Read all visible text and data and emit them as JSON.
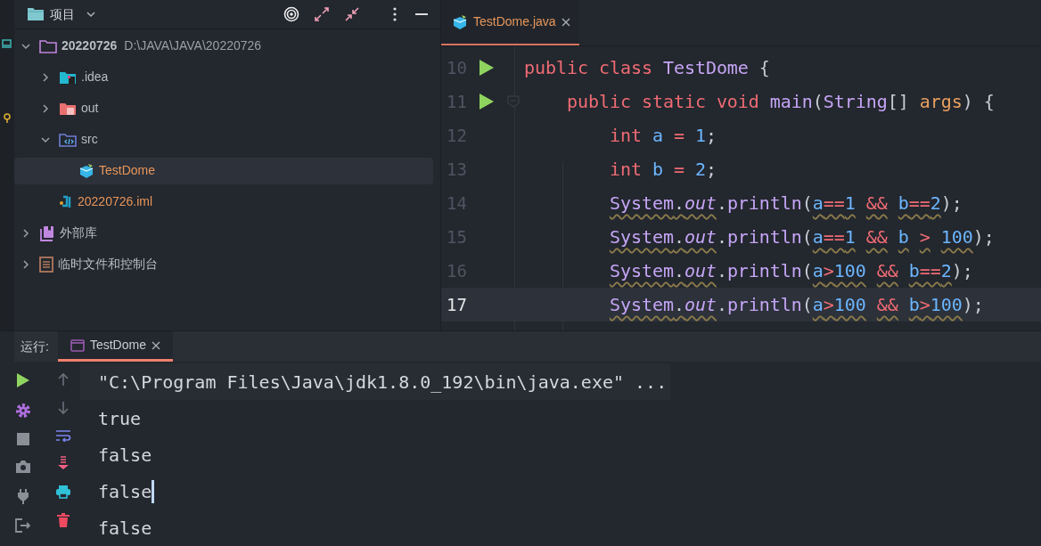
{
  "project_panel": {
    "title": "项目",
    "tree": [
      {
        "label": "20220726",
        "path": "D:\\JAVA\\JAVA\\20220726",
        "kind": "module",
        "expanded": true,
        "selected": false,
        "color": "#b8bcc4",
        "children": [
          {
            "label": ".idea",
            "kind": "idea-folder",
            "expanded": false,
            "selected": false,
            "color": "#b8bcc4"
          },
          {
            "label": "out",
            "kind": "out-folder",
            "expanded": false,
            "selected": false,
            "color": "#b8bcc4"
          },
          {
            "label": "src",
            "kind": "source-folder",
            "expanded": true,
            "selected": false,
            "color": "#b8bcc4",
            "children": [
              {
                "label": "TestDome",
                "kind": "java-class",
                "selected": true,
                "color": "#e8965a"
              }
            ]
          },
          {
            "label": "20220726.iml",
            "kind": "iml-file",
            "selected": false,
            "color": "#e8965a"
          }
        ]
      },
      {
        "label": "外部库",
        "kind": "library",
        "expanded": false,
        "selected": false,
        "color": "#b8bcc4"
      },
      {
        "label": "临时文件和控制台",
        "kind": "scratch",
        "expanded": false,
        "selected": false,
        "color": "#b8bcc4"
      }
    ]
  },
  "editor": {
    "tabs": [
      {
        "label": "TestDome.java",
        "selected": true
      }
    ],
    "lines": [
      {
        "number": "10",
        "runnable": true,
        "foldable": false,
        "current": false,
        "tokens": [
          {
            "text": "public",
            "kind": "keyword",
            "squiggle": false
          },
          {
            "text": " class",
            "kind": "keyword",
            "squiggle": false
          },
          {
            "text": " TestDome",
            "kind": "type",
            "squiggle": false
          },
          {
            "text": " {",
            "kind": "punct",
            "squiggle": false
          }
        ]
      },
      {
        "number": "11",
        "runnable": true,
        "foldable": true,
        "current": false,
        "tokens": [
          {
            "text": "    public",
            "kind": "keyword",
            "squiggle": false
          },
          {
            "text": " static",
            "kind": "keyword",
            "squiggle": false
          },
          {
            "text": " void",
            "kind": "keyword",
            "squiggle": false
          },
          {
            "text": " main",
            "kind": "method",
            "squiggle": false
          },
          {
            "text": "(",
            "kind": "punct",
            "squiggle": false
          },
          {
            "text": "String",
            "kind": "type",
            "squiggle": false
          },
          {
            "text": "[]",
            "kind": "punct",
            "squiggle": false
          },
          {
            "text": " args",
            "kind": "param",
            "squiggle": false
          },
          {
            "text": ")",
            "kind": "punct",
            "squiggle": false
          },
          {
            "text": " {",
            "kind": "punct",
            "squiggle": false
          }
        ]
      },
      {
        "number": "12",
        "runnable": false,
        "foldable": false,
        "current": false,
        "tokens": [
          {
            "text": "        int",
            "kind": "keyword",
            "squiggle": false
          },
          {
            "text": " a",
            "kind": "variable",
            "squiggle": false
          },
          {
            "text": " =",
            "kind": "operator",
            "squiggle": false
          },
          {
            "text": " 1",
            "kind": "number",
            "squiggle": false
          },
          {
            "text": ";",
            "kind": "punct",
            "squiggle": false
          }
        ]
      },
      {
        "number": "13",
        "runnable": false,
        "foldable": false,
        "current": false,
        "tokens": [
          {
            "text": "        int",
            "kind": "keyword",
            "squiggle": false
          },
          {
            "text": " b",
            "kind": "variable",
            "squiggle": false
          },
          {
            "text": " =",
            "kind": "operator",
            "squiggle": false
          },
          {
            "text": " 2",
            "kind": "number",
            "squiggle": false
          },
          {
            "text": ";",
            "kind": "punct",
            "squiggle": false
          }
        ]
      },
      {
        "number": "14",
        "runnable": false,
        "foldable": false,
        "current": false,
        "tokens": [
          {
            "text": "        System",
            "kind": "type",
            "squiggle": true
          },
          {
            "text": ".",
            "kind": "punct",
            "squiggle": true
          },
          {
            "text": "out",
            "kind": "field",
            "squiggle": true
          },
          {
            "text": ".",
            "kind": "punct",
            "squiggle": false
          },
          {
            "text": "println",
            "kind": "method",
            "squiggle": false
          },
          {
            "text": "(",
            "kind": "punct",
            "squiggle": false
          },
          {
            "text": "a",
            "kind": "variable",
            "squiggle": true
          },
          {
            "text": "==",
            "kind": "operator",
            "squiggle": true
          },
          {
            "text": "1",
            "kind": "number",
            "squiggle": true
          },
          {
            "text": " &&",
            "kind": "operator",
            "squiggle": true
          },
          {
            "text": " b",
            "kind": "variable",
            "squiggle": true
          },
          {
            "text": "==",
            "kind": "operator",
            "squiggle": true
          },
          {
            "text": "2",
            "kind": "number",
            "squiggle": true
          },
          {
            "text": ")",
            "kind": "punct",
            "squiggle": false
          },
          {
            "text": ";",
            "kind": "punct",
            "squiggle": false
          }
        ]
      },
      {
        "number": "15",
        "runnable": false,
        "foldable": false,
        "current": false,
        "tokens": [
          {
            "text": "        System",
            "kind": "type",
            "squiggle": true
          },
          {
            "text": ".",
            "kind": "punct",
            "squiggle": true
          },
          {
            "text": "out",
            "kind": "field",
            "squiggle": true
          },
          {
            "text": ".",
            "kind": "punct",
            "squiggle": false
          },
          {
            "text": "println",
            "kind": "method",
            "squiggle": false
          },
          {
            "text": "(",
            "kind": "punct",
            "squiggle": false
          },
          {
            "text": "a",
            "kind": "variable",
            "squiggle": true
          },
          {
            "text": "==",
            "kind": "operator",
            "squiggle": true
          },
          {
            "text": "1",
            "kind": "number",
            "squiggle": true
          },
          {
            "text": " &&",
            "kind": "operator",
            "squiggle": true
          },
          {
            "text": " b",
            "kind": "variable",
            "squiggle": true
          },
          {
            "text": " >",
            "kind": "operator",
            "squiggle": true
          },
          {
            "text": " 100",
            "kind": "number",
            "squiggle": true
          },
          {
            "text": ")",
            "kind": "punct",
            "squiggle": false
          },
          {
            "text": ";",
            "kind": "punct",
            "squiggle": false
          }
        ]
      },
      {
        "number": "16",
        "runnable": false,
        "foldable": false,
        "current": false,
        "tokens": [
          {
            "text": "        System",
            "kind": "type",
            "squiggle": true
          },
          {
            "text": ".",
            "kind": "punct",
            "squiggle": true
          },
          {
            "text": "out",
            "kind": "field",
            "squiggle": true
          },
          {
            "text": ".",
            "kind": "punct",
            "squiggle": false
          },
          {
            "text": "println",
            "kind": "method",
            "squiggle": false
          },
          {
            "text": "(",
            "kind": "punct",
            "squiggle": false
          },
          {
            "text": "a",
            "kind": "variable",
            "squiggle": true
          },
          {
            "text": ">",
            "kind": "operator",
            "squiggle": true
          },
          {
            "text": "100",
            "kind": "number",
            "squiggle": true
          },
          {
            "text": " &&",
            "kind": "operator",
            "squiggle": true
          },
          {
            "text": " b",
            "kind": "variable",
            "squiggle": true
          },
          {
            "text": "==",
            "kind": "operator",
            "squiggle": true
          },
          {
            "text": "2",
            "kind": "number",
            "squiggle": true
          },
          {
            "text": ")",
            "kind": "punct",
            "squiggle": false
          },
          {
            "text": ";",
            "kind": "punct",
            "squiggle": false
          }
        ]
      },
      {
        "number": "17",
        "runnable": false,
        "foldable": false,
        "current": true,
        "tokens": [
          {
            "text": "        System",
            "kind": "type",
            "squiggle": true
          },
          {
            "text": ".",
            "kind": "punct",
            "squiggle": true
          },
          {
            "text": "out",
            "kind": "field",
            "squiggle": true
          },
          {
            "text": ".",
            "kind": "punct",
            "squiggle": false
          },
          {
            "text": "println",
            "kind": "method",
            "squiggle": false
          },
          {
            "text": "(",
            "kind": "punct",
            "squiggle": false
          },
          {
            "text": "a",
            "kind": "variable",
            "squiggle": true
          },
          {
            "text": ">",
            "kind": "operator",
            "squiggle": true
          },
          {
            "text": "100",
            "kind": "number",
            "squiggle": true
          },
          {
            "text": " &&",
            "kind": "operator",
            "squiggle": true
          },
          {
            "text": " b",
            "kind": "variable",
            "squiggle": true
          },
          {
            "text": ">",
            "kind": "operator",
            "squiggle": true
          },
          {
            "text": "100",
            "kind": "number",
            "squiggle": true
          },
          {
            "text": ")",
            "kind": "punct",
            "squiggle": false
          },
          {
            "text": ";",
            "kind": "punct",
            "squiggle": false
          }
        ]
      }
    ]
  },
  "run_panel": {
    "label": "运行:",
    "tabs": [
      {
        "label": "TestDome",
        "selected": true
      }
    ],
    "output": [
      {
        "text": "\"C:\\Program Files\\Java\\jdk1.8.0_192\\bin\\java.exe\" ...",
        "kind": "command",
        "caret": false
      },
      {
        "text": "true",
        "kind": "stdout",
        "caret": false
      },
      {
        "text": "false",
        "kind": "stdout",
        "caret": false
      },
      {
        "text": "false",
        "kind": "stdout",
        "caret": true
      },
      {
        "text": "false",
        "kind": "stdout",
        "caret": false
      }
    ]
  }
}
